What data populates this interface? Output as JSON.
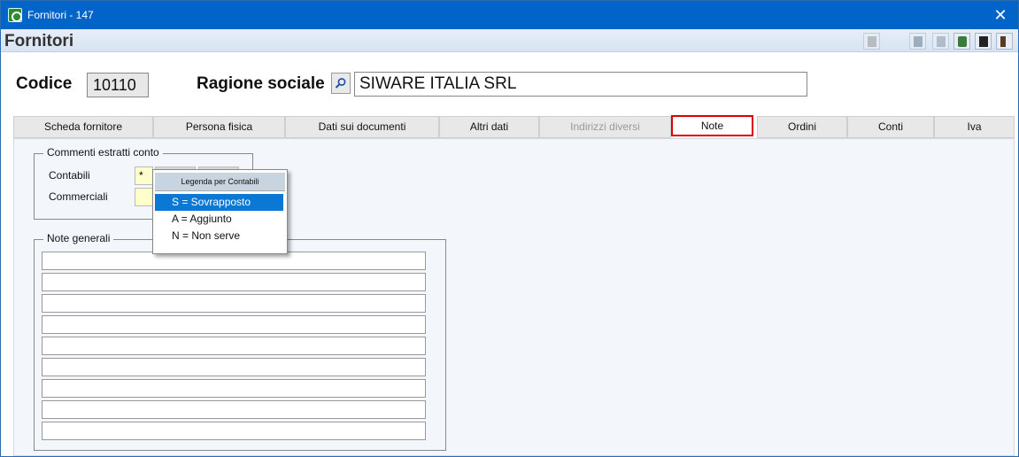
{
  "window": {
    "title": "Fornitori - 147"
  },
  "form": {
    "title": "Fornitori"
  },
  "header": {
    "codice_label": "Codice",
    "codice_value": "10110",
    "ragione_label": "Ragione sociale",
    "ragione_value": "SIWARE ITALIA SRL"
  },
  "tabs": [
    {
      "label": "Scheda fornitore"
    },
    {
      "label": "Persona fisica"
    },
    {
      "label": "Dati sui documenti"
    },
    {
      "label": "Altri dati"
    },
    {
      "label": "Indirizzi diversi"
    },
    {
      "label": "Note"
    },
    {
      "label": "Ordini"
    },
    {
      "label": "Conti"
    },
    {
      "label": "Iva"
    }
  ],
  "commenti": {
    "legend": "Commenti estratti conto",
    "contabili_label": "Contabili",
    "contabili_value": "*",
    "commerciali_label": "Commerciali",
    "commerciali_value": ""
  },
  "note_generali": {
    "legend": "Note generali"
  },
  "popup": {
    "header": "Legenda per Contabili",
    "options": [
      {
        "label": "S = Sovrapposto",
        "selected": true
      },
      {
        "label": "A = Aggiunto",
        "selected": false
      },
      {
        "label": "N = Non serve",
        "selected": false
      }
    ]
  },
  "toolbar_icons": [
    "page-icon",
    "screen-icon",
    "copy-icon",
    "recycle-icon",
    "save-icon",
    "exit-icon"
  ],
  "colors": {
    "titlebar": "#0064c8",
    "active_tab_border": "#dd0000",
    "selected_option": "#0a78d4",
    "input_yellow": "#ffffcc"
  }
}
